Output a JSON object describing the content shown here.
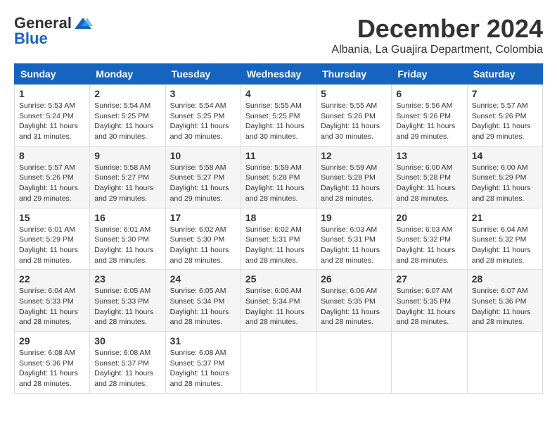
{
  "header": {
    "logo_general": "General",
    "logo_blue": "Blue",
    "month_title": "December 2024",
    "subtitle": "Albania, La Guajira Department, Colombia"
  },
  "weekdays": [
    "Sunday",
    "Monday",
    "Tuesday",
    "Wednesday",
    "Thursday",
    "Friday",
    "Saturday"
  ],
  "weeks": [
    [
      {
        "day": "1",
        "sunrise": "Sunrise: 5:53 AM",
        "sunset": "Sunset: 5:24 PM",
        "daylight": "Daylight: 11 hours and 31 minutes."
      },
      {
        "day": "2",
        "sunrise": "Sunrise: 5:54 AM",
        "sunset": "Sunset: 5:25 PM",
        "daylight": "Daylight: 11 hours and 30 minutes."
      },
      {
        "day": "3",
        "sunrise": "Sunrise: 5:54 AM",
        "sunset": "Sunset: 5:25 PM",
        "daylight": "Daylight: 11 hours and 30 minutes."
      },
      {
        "day": "4",
        "sunrise": "Sunrise: 5:55 AM",
        "sunset": "Sunset: 5:25 PM",
        "daylight": "Daylight: 11 hours and 30 minutes."
      },
      {
        "day": "5",
        "sunrise": "Sunrise: 5:55 AM",
        "sunset": "Sunset: 5:26 PM",
        "daylight": "Daylight: 11 hours and 30 minutes."
      },
      {
        "day": "6",
        "sunrise": "Sunrise: 5:56 AM",
        "sunset": "Sunset: 5:26 PM",
        "daylight": "Daylight: 11 hours and 29 minutes."
      },
      {
        "day": "7",
        "sunrise": "Sunrise: 5:57 AM",
        "sunset": "Sunset: 5:26 PM",
        "daylight": "Daylight: 11 hours and 29 minutes."
      }
    ],
    [
      {
        "day": "8",
        "sunrise": "Sunrise: 5:57 AM",
        "sunset": "Sunset: 5:26 PM",
        "daylight": "Daylight: 11 hours and 29 minutes."
      },
      {
        "day": "9",
        "sunrise": "Sunrise: 5:58 AM",
        "sunset": "Sunset: 5:27 PM",
        "daylight": "Daylight: 11 hours and 29 minutes."
      },
      {
        "day": "10",
        "sunrise": "Sunrise: 5:58 AM",
        "sunset": "Sunset: 5:27 PM",
        "daylight": "Daylight: 11 hours and 29 minutes."
      },
      {
        "day": "11",
        "sunrise": "Sunrise: 5:59 AM",
        "sunset": "Sunset: 5:28 PM",
        "daylight": "Daylight: 11 hours and 28 minutes."
      },
      {
        "day": "12",
        "sunrise": "Sunrise: 5:59 AM",
        "sunset": "Sunset: 5:28 PM",
        "daylight": "Daylight: 11 hours and 28 minutes."
      },
      {
        "day": "13",
        "sunrise": "Sunrise: 6:00 AM",
        "sunset": "Sunset: 5:28 PM",
        "daylight": "Daylight: 11 hours and 28 minutes."
      },
      {
        "day": "14",
        "sunrise": "Sunrise: 6:00 AM",
        "sunset": "Sunset: 5:29 PM",
        "daylight": "Daylight: 11 hours and 28 minutes."
      }
    ],
    [
      {
        "day": "15",
        "sunrise": "Sunrise: 6:01 AM",
        "sunset": "Sunset: 5:29 PM",
        "daylight": "Daylight: 11 hours and 28 minutes."
      },
      {
        "day": "16",
        "sunrise": "Sunrise: 6:01 AM",
        "sunset": "Sunset: 5:30 PM",
        "daylight": "Daylight: 11 hours and 28 minutes."
      },
      {
        "day": "17",
        "sunrise": "Sunrise: 6:02 AM",
        "sunset": "Sunset: 5:30 PM",
        "daylight": "Daylight: 11 hours and 28 minutes."
      },
      {
        "day": "18",
        "sunrise": "Sunrise: 6:02 AM",
        "sunset": "Sunset: 5:31 PM",
        "daylight": "Daylight: 11 hours and 28 minutes."
      },
      {
        "day": "19",
        "sunrise": "Sunrise: 6:03 AM",
        "sunset": "Sunset: 5:31 PM",
        "daylight": "Daylight: 11 hours and 28 minutes."
      },
      {
        "day": "20",
        "sunrise": "Sunrise: 6:03 AM",
        "sunset": "Sunset: 5:32 PM",
        "daylight": "Daylight: 11 hours and 28 minutes."
      },
      {
        "day": "21",
        "sunrise": "Sunrise: 6:04 AM",
        "sunset": "Sunset: 5:32 PM",
        "daylight": "Daylight: 11 hours and 28 minutes."
      }
    ],
    [
      {
        "day": "22",
        "sunrise": "Sunrise: 6:04 AM",
        "sunset": "Sunset: 5:33 PM",
        "daylight": "Daylight: 11 hours and 28 minutes."
      },
      {
        "day": "23",
        "sunrise": "Sunrise: 6:05 AM",
        "sunset": "Sunset: 5:33 PM",
        "daylight": "Daylight: 11 hours and 28 minutes."
      },
      {
        "day": "24",
        "sunrise": "Sunrise: 6:05 AM",
        "sunset": "Sunset: 5:34 PM",
        "daylight": "Daylight: 11 hours and 28 minutes."
      },
      {
        "day": "25",
        "sunrise": "Sunrise: 6:06 AM",
        "sunset": "Sunset: 5:34 PM",
        "daylight": "Daylight: 11 hours and 28 minutes."
      },
      {
        "day": "26",
        "sunrise": "Sunrise: 6:06 AM",
        "sunset": "Sunset: 5:35 PM",
        "daylight": "Daylight: 11 hours and 28 minutes."
      },
      {
        "day": "27",
        "sunrise": "Sunrise: 6:07 AM",
        "sunset": "Sunset: 5:35 PM",
        "daylight": "Daylight: 11 hours and 28 minutes."
      },
      {
        "day": "28",
        "sunrise": "Sunrise: 6:07 AM",
        "sunset": "Sunset: 5:36 PM",
        "daylight": "Daylight: 11 hours and 28 minutes."
      }
    ],
    [
      {
        "day": "29",
        "sunrise": "Sunrise: 6:08 AM",
        "sunset": "Sunset: 5:36 PM",
        "daylight": "Daylight: 11 hours and 28 minutes."
      },
      {
        "day": "30",
        "sunrise": "Sunrise: 6:08 AM",
        "sunset": "Sunset: 5:37 PM",
        "daylight": "Daylight: 11 hours and 28 minutes."
      },
      {
        "day": "31",
        "sunrise": "Sunrise: 6:08 AM",
        "sunset": "Sunset: 5:37 PM",
        "daylight": "Daylight: 11 hours and 28 minutes."
      },
      null,
      null,
      null,
      null
    ]
  ]
}
